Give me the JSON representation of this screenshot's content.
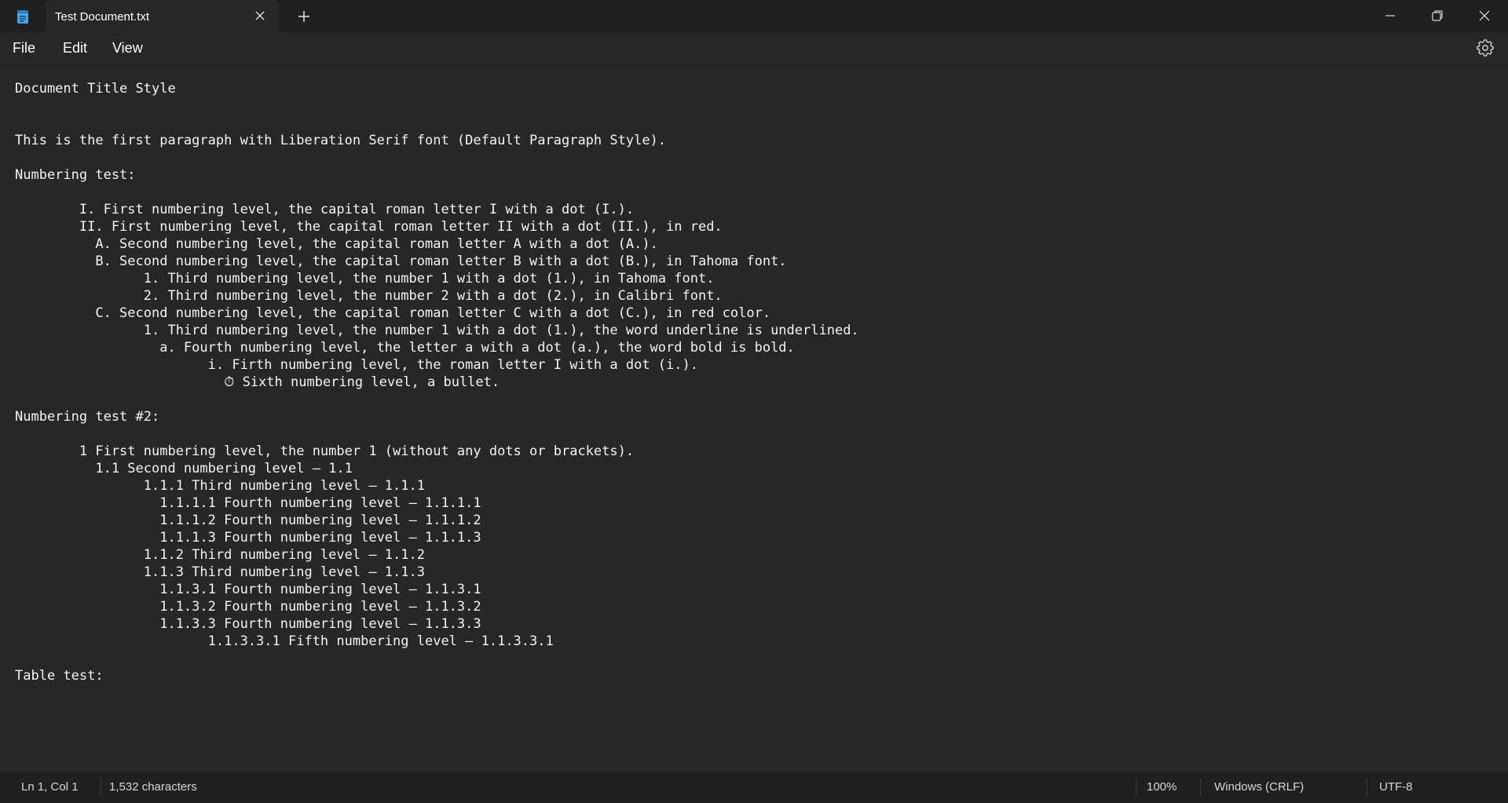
{
  "tab": {
    "title": "Test Document.txt"
  },
  "menu": {
    "file": "File",
    "edit": "Edit",
    "view": "View"
  },
  "document": {
    "lines": [
      "Document Title Style",
      "",
      "",
      "This is the first paragraph with Liberation Serif font (Default Paragraph Style).",
      "",
      "Numbering test:",
      "",
      "        I. First numbering level, the capital roman letter I with a dot (I.).",
      "        II. First numbering level, the capital roman letter II with a dot (II.), in red.",
      "          A. Second numbering level, the capital roman letter A with a dot (A.).",
      "          B. Second numbering level, the capital roman letter B with a dot (B.), in Tahoma font.",
      "                1. Third numbering level, the number 1 with a dot (1.), in Tahoma font.",
      "                2. Third numbering level, the number 2 with a dot (2.), in Calibri font.",
      "          C. Second numbering level, the capital roman letter C with a dot (C.), in red color.",
      "                1. Third numbering level, the number 1 with a dot (1.), the word underline is underlined.",
      "                  a. Fourth numbering level, the letter a with a dot (a.), the word bold is bold.",
      "                        i. Firth numbering level, the roman letter I with a dot (i.).",
      "                          ⏱ Sixth numbering level, a bullet.",
      "",
      "Numbering test #2:",
      "",
      "        1 First numbering level, the number 1 (without any dots or brackets).",
      "          1.1 Second numbering level – 1.1",
      "                1.1.1 Third numbering level – 1.1.1",
      "                  1.1.1.1 Fourth numbering level – 1.1.1.1",
      "                  1.1.1.2 Fourth numbering level – 1.1.1.2",
      "                  1.1.1.3 Fourth numbering level – 1.1.1.3",
      "                1.1.2 Third numbering level – 1.1.2",
      "                1.1.3 Third numbering level – 1.1.3",
      "                  1.1.3.1 Fourth numbering level – 1.1.3.1",
      "                  1.1.3.2 Fourth numbering level – 1.1.3.2",
      "                  1.1.3.3 Fourth numbering level – 1.1.3.3",
      "                        1.1.3.3.1 Fifth numbering level – 1.1.3.3.1",
      "",
      "Table test:"
    ]
  },
  "status": {
    "position": "Ln 1, Col 1",
    "characters": "1,532 characters",
    "zoom": "100%",
    "line_ending": "Windows (CRLF)",
    "encoding": "UTF-8"
  },
  "icons": {
    "app": "notepad-icon",
    "close": "close-icon",
    "add": "plus-icon",
    "settings": "gear-icon"
  }
}
